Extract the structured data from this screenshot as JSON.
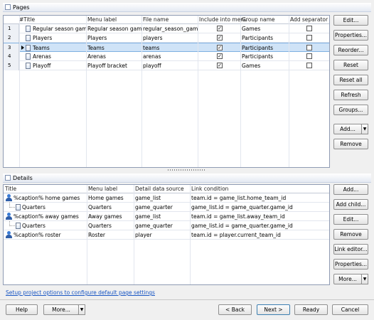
{
  "pages": {
    "group_label": "Pages",
    "columns": [
      "#",
      "Title",
      "Menu label",
      "File name",
      "Include into menu",
      "Group name",
      "Add separator"
    ],
    "rows": [
      {
        "num": "1",
        "title": "Regular season games",
        "menu_label": "Regular season games",
        "file_name": "regular_season_games",
        "include": true,
        "group": "Games",
        "separator": false
      },
      {
        "num": "2",
        "title": "Players",
        "menu_label": "Players",
        "file_name": "players",
        "include": true,
        "group": "Participants",
        "separator": false
      },
      {
        "num": "3",
        "title": "Teams",
        "menu_label": "Teams",
        "file_name": "teams",
        "include": true,
        "group": "Participants",
        "separator": false,
        "selected": true
      },
      {
        "num": "4",
        "title": "Arenas",
        "menu_label": "Arenas",
        "file_name": "arenas",
        "include": true,
        "group": "Participants",
        "separator": false
      },
      {
        "num": "5",
        "title": "Playoff",
        "menu_label": "Playoff bracket",
        "file_name": "playoff",
        "include": true,
        "group": "Games",
        "separator": false
      }
    ],
    "buttons": {
      "edit": "Edit...",
      "properties": "Properties...",
      "reorder": "Reorder...",
      "reset": "Reset",
      "reset_all": "Reset all",
      "refresh": "Refresh",
      "groups": "Groups...",
      "add": "Add...",
      "remove": "Remove"
    }
  },
  "details": {
    "group_label": "Details",
    "columns": [
      "Title",
      "Menu label",
      "Detail data source",
      "Link condition"
    ],
    "rows": [
      {
        "title": "%caption% home games",
        "menu_label": "Home games",
        "source": "game_list",
        "condition": "team.id = game_list.home_team_id",
        "level": 0
      },
      {
        "title": "Quarters",
        "menu_label": "Quarters",
        "source": "game_quarter",
        "condition": "game_list.id = game_quarter.game_id",
        "level": 1
      },
      {
        "title": "%caption% away games",
        "menu_label": "Away games",
        "source": "game_list",
        "condition": "team.id = game_list.away_team_id",
        "level": 0
      },
      {
        "title": "Quarters",
        "menu_label": "Quarters",
        "source": "game_quarter",
        "condition": "game_list.id = game_quarter.game_id",
        "level": 1
      },
      {
        "title": "%caption% roster",
        "menu_label": "Roster",
        "source": "player",
        "condition": "team.id = player.current_team_id",
        "level": 0
      }
    ],
    "buttons": {
      "add": "Add...",
      "add_child": "Add child...",
      "edit": "Edit...",
      "remove": "Remove",
      "link_editor": "Link editor...",
      "properties": "Properties...",
      "more": "More..."
    }
  },
  "setup_link": "Setup project options to configure default page settings",
  "footer": {
    "help": "Help",
    "more": "More...",
    "back": "< Back",
    "next": "Next >",
    "ready": "Ready",
    "cancel": "Cancel"
  },
  "colors": {
    "selection": "#cfe3f7",
    "link": "#1a57c4",
    "grid_border": "#8f9bb3"
  }
}
